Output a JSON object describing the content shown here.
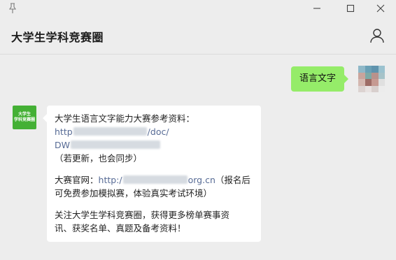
{
  "window": {
    "controls": {
      "pin_icon": "pin-icon",
      "minimize_icon": "minimize-icon",
      "maximize_icon": "maximize-icon",
      "close_icon": "close-icon"
    }
  },
  "header": {
    "title": "大学生学科竞赛圈",
    "profile_icon": "person-icon"
  },
  "colors": {
    "background": "#ededed",
    "outgoing_bubble": "#95ec69",
    "incoming_bubble": "#ffffff",
    "link": "#576b95",
    "bot_avatar": "#44b035"
  },
  "messages": {
    "outgoing": {
      "text": "语言文字"
    },
    "incoming": {
      "avatar_lines": [
        "大学生",
        "学科竞赛圈"
      ],
      "line1": "大学生语言文字能力大赛参考资料：",
      "url_part1_start": "http",
      "url_part1_end": "/doc/",
      "url_part2_start": "DW",
      "line4": "（若更新，也会同步）",
      "site_label": "大赛官网：",
      "site_url_start": "http:/",
      "site_url_end": "org.cn",
      "site_note_a": "（报名后",
      "site_note_b": "可免费参加模拟赛，体验真实考试环境）",
      "follow_line1": "关注大学生学科竞赛圈，获得更多榜单赛事资",
      "follow_line2": "讯、获奖名单、真题及备考资料！"
    }
  }
}
